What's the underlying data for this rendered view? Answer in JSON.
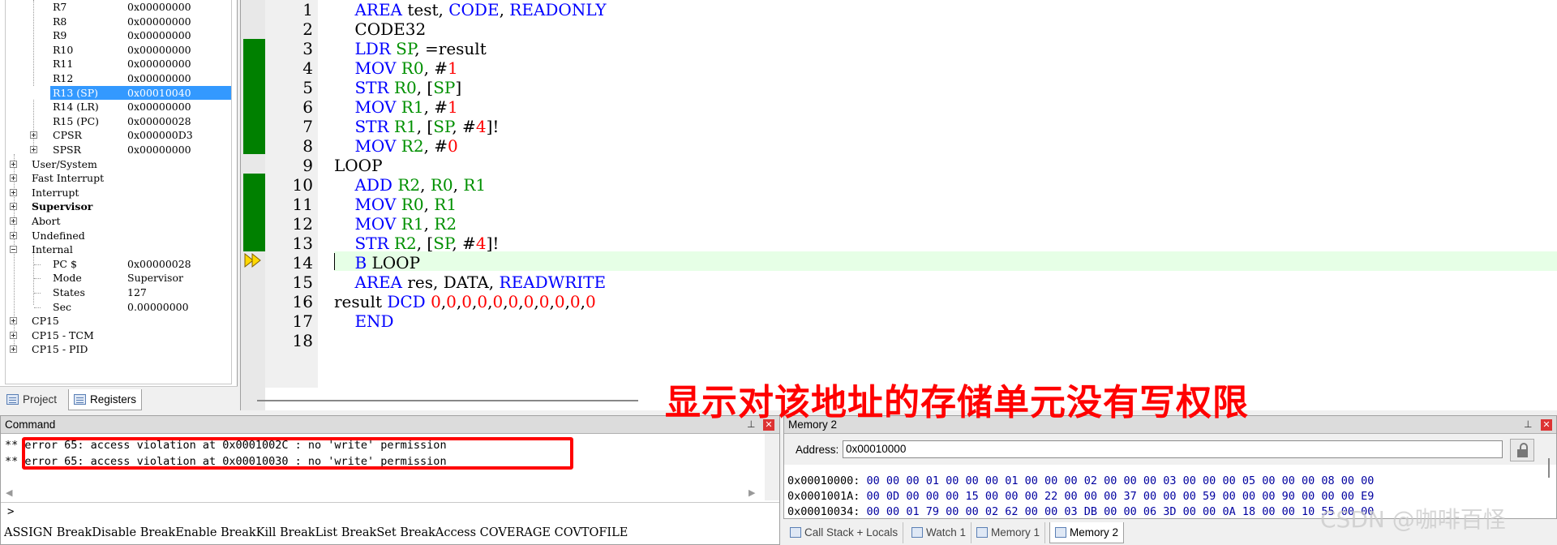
{
  "registers": {
    "rows": [
      {
        "name": "R7",
        "value": "0x00000000"
      },
      {
        "name": "R8",
        "value": "0x00000000"
      },
      {
        "name": "R9",
        "value": "0x00000000"
      },
      {
        "name": "R10",
        "value": "0x00000000"
      },
      {
        "name": "R11",
        "value": "0x00000000"
      },
      {
        "name": "R12",
        "value": "0x00000000"
      },
      {
        "name": "R13 (SP)",
        "value": "0x00010040"
      },
      {
        "name": "R14 (LR)",
        "value": "0x00000000"
      },
      {
        "name": "R15 (PC)",
        "value": "0x00000028"
      },
      {
        "name": "CPSR",
        "value": "0x000000D3"
      },
      {
        "name": "SPSR",
        "value": "0x00000000"
      }
    ],
    "groups": [
      {
        "name": "User/System"
      },
      {
        "name": "Fast Interrupt"
      },
      {
        "name": "Interrupt"
      },
      {
        "name": "Supervisor"
      },
      {
        "name": "Abort"
      },
      {
        "name": "Undefined"
      },
      {
        "name": "Internal"
      }
    ],
    "internal": [
      {
        "name": "PC  $",
        "value": "0x00000028"
      },
      {
        "name": "Mode",
        "value": "Supervisor"
      },
      {
        "name": "States",
        "value": "127"
      },
      {
        "name": "Sec",
        "value": "0.00000000"
      }
    ],
    "cp_groups": [
      {
        "name": "CP15"
      },
      {
        "name": "CP15 - TCM"
      },
      {
        "name": "CP15 - PID"
      }
    ]
  },
  "panel_tabs": {
    "project": "Project",
    "registers": "Registers"
  },
  "editor": {
    "line_numbers": [
      "1",
      "2",
      "3",
      "4",
      "5",
      "6",
      "7",
      "8",
      "9",
      "10",
      "11",
      "12",
      "13",
      "14",
      "15",
      "16",
      "17",
      "18"
    ]
  },
  "command": {
    "title": "Command",
    "lines": [
      {
        "prefix": "**",
        "text": " error 65: access violation at 0x0001002C : no 'write' permission"
      },
      {
        "prefix": "**",
        "text": " error 65: access violation at 0x00010030 : no 'write' permission"
      }
    ],
    "prompt": ">",
    "help": "ASSIGN BreakDisable BreakEnable BreakKill BreakList BreakSet BreakAccess COVERAGE COVTOFILE"
  },
  "memory": {
    "title": "Memory 2",
    "address_label": "Address:",
    "address_value": "0x00010000",
    "rows": [
      {
        "addr": "0x00010000:",
        "bytes": "00 00 00 01 00 00 00 01 00 00 00 02 00 00 00 03 00 00 00 05 00 00 00 08 00 00"
      },
      {
        "addr": "0x0001001A:",
        "bytes": "00 0D 00 00 00 15 00 00 00 22 00 00 00 37 00 00 00 59 00 00 00 90 00 00 00 E9"
      },
      {
        "addr": "0x00010034:",
        "bytes": "00 00 01 79 00 00 02 62 00 00 03 DB 00 00 06 3D 00 00 0A 18 00 00 10 55 00 00"
      }
    ],
    "tabs": [
      "Call Stack + Locals",
      "Watch 1",
      "Memory 1",
      "Memory 2"
    ]
  },
  "annotation": "显示对该地址的存储单元没有写权限",
  "watermark": "CSDN @咖啡百怪",
  "colors": {
    "keyword": "#0000ff",
    "register": "#009000",
    "number": "#ff0000",
    "highlight": "#ff0000",
    "gutter_coverage": "#008000"
  }
}
